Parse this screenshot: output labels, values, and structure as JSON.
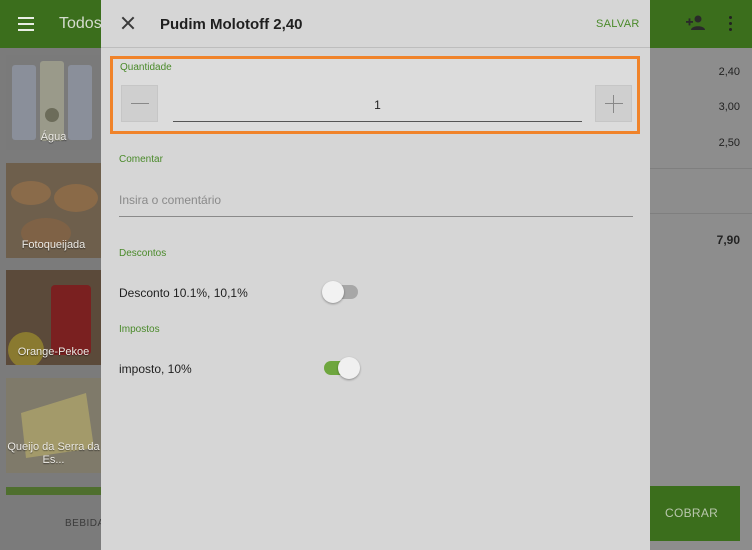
{
  "app": {
    "header_title": "Todos",
    "tiles": [
      {
        "label": "Água"
      },
      {
        "label": "Fotoqueijada"
      },
      {
        "label": "Orange-Pekoe"
      },
      {
        "label": "Queijo da Serra da Es..."
      }
    ],
    "bottom_tab": "BEBIDA",
    "ticket_prices": [
      "2,40",
      "3,00",
      "2,50"
    ],
    "total": "7,90",
    "charge_label": "COBRAR"
  },
  "dialog": {
    "title": "Pudim Molotoff 2,40",
    "save_label": "SALVAR",
    "quantity": {
      "label": "Quantidade",
      "value": "1"
    },
    "comment": {
      "label": "Comentar",
      "placeholder": "Insira o comentário",
      "value": ""
    },
    "discounts": {
      "label": "Descontos",
      "items": [
        {
          "label": "Desconto 10.1%, 10,1%",
          "enabled": false
        }
      ]
    },
    "taxes": {
      "label": "Impostos",
      "items": [
        {
          "label": "imposto, 10%",
          "enabled": true
        }
      ]
    }
  },
  "colors": {
    "brand_green": "#4a8a2a",
    "highlight_orange": "#f0832a",
    "toggle_on": "#6ea63e"
  }
}
